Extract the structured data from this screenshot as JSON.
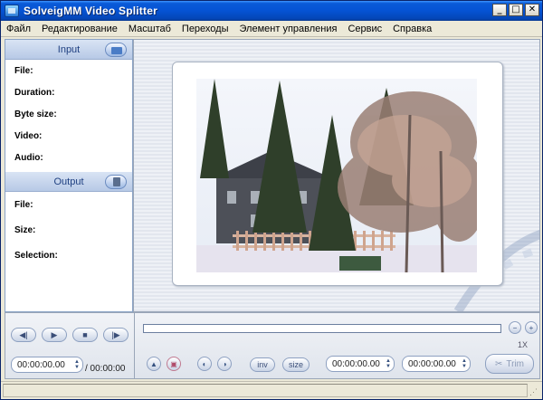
{
  "window": {
    "title": "SolveigMM Video Splitter",
    "controls": [
      "_",
      "□",
      "✕"
    ]
  },
  "menu": [
    "Файл",
    "Редактирование",
    "Масштаб",
    "Переходы",
    "Элемент управления",
    "Сервис",
    "Справка"
  ],
  "input_panel": {
    "header": "Input",
    "labels": [
      "File:",
      "Duration:",
      "Byte size:",
      "Video:",
      "Audio:"
    ]
  },
  "output_panel": {
    "header": "Output",
    "labels": [
      "File:",
      "Size:",
      "Selection:"
    ]
  },
  "playback": {
    "current_time": "00:00:00.00",
    "total_time": "/ 00:00:00"
  },
  "editing": {
    "inv_label": "inv",
    "size_label": "size",
    "mark_in_time": "00:00:00.00",
    "mark_out_time": "00:00:00.00",
    "zoom": "1X",
    "trim_label": "Trim"
  },
  "colors": {
    "titlebar": "#0553d4",
    "panel_header_text": "#1e3f80"
  }
}
